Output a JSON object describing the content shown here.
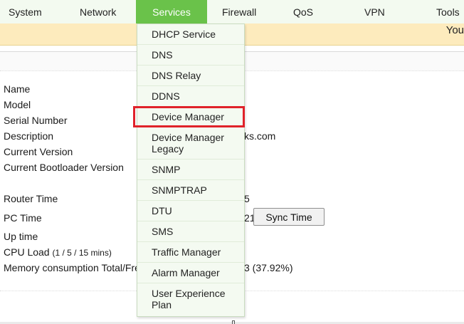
{
  "nav": {
    "items": [
      "System",
      "Network",
      "Services",
      "Firewall",
      "QoS",
      "VPN",
      "Tools"
    ],
    "active": "Services"
  },
  "banner": {
    "text": "You"
  },
  "info": {
    "labels": {
      "name": "Name",
      "model": "Model",
      "serial": "Serial Number",
      "description": "Description",
      "current_version": "Current Version",
      "bootloader": "Current Bootloader Version",
      "router_time": "Router Time",
      "pc_time": "PC Time",
      "uptime": "Up time",
      "cpu_load": "CPU Load",
      "cpu_load_sub": "(1 / 5 / 15 mins)",
      "memory": "Memory consumption Total/Fre"
    },
    "partial_values": {
      "description": "ks.com",
      "router_time": "5",
      "pc_time": "21",
      "memory": "3 (37.92%)"
    },
    "sync_button": "Sync Time"
  },
  "services_menu": {
    "items": [
      "DHCP Service",
      "DNS",
      "DNS Relay",
      "DDNS",
      "Device Manager",
      "Device Manager Legacy",
      "SNMP",
      "SNMPTRAP",
      "DTU",
      "SMS",
      "Traffic Manager",
      "Alarm Manager",
      "User Experience Plan"
    ],
    "highlighted": "Device Manager"
  },
  "colors": {
    "nav_bg": "#f3faf0",
    "nav_active": "#6ac24a",
    "banner_bg": "#fdebbd",
    "highlight_border": "#e0222a",
    "menu_bg": "#f4faf1"
  }
}
